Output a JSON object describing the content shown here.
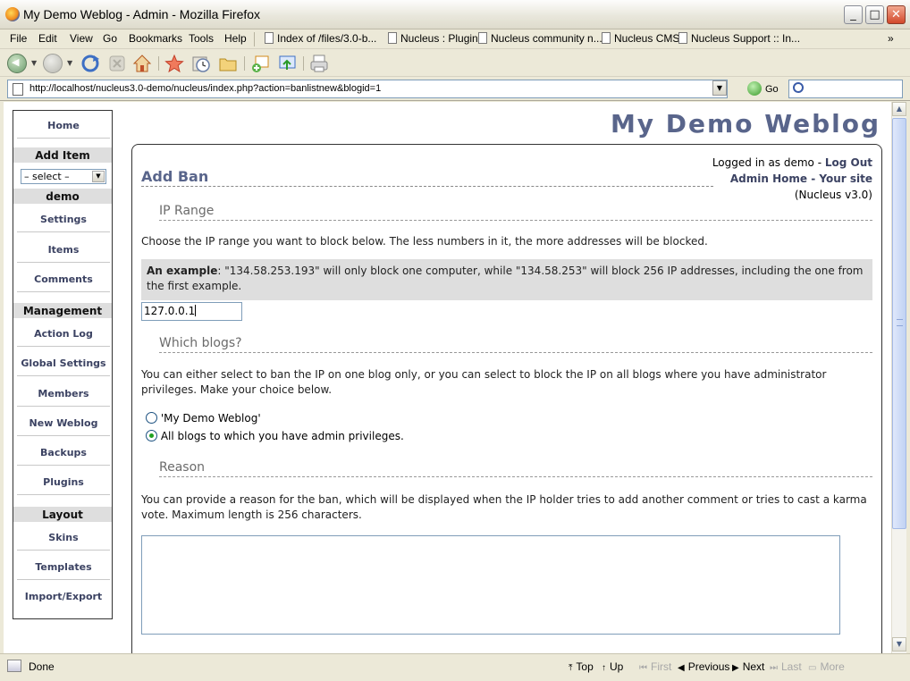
{
  "window": {
    "title": "My Demo Weblog - Admin - Mozilla Firefox",
    "buttons": {
      "minimize": "_",
      "maximize": "□",
      "close": "✕"
    }
  },
  "menubar": {
    "items": [
      "File",
      "Edit",
      "View",
      "Go",
      "Bookmarks",
      "Tools",
      "Help"
    ],
    "accel": [
      "F",
      "E",
      "V",
      "G",
      "B",
      "T",
      "H"
    ],
    "bookmarks": [
      "Index of /files/3.0-b...",
      "Nucleus : Plugin",
      "Nucleus community n...",
      "Nucleus CMS",
      "Nucleus Support :: In..."
    ],
    "overflow": "»"
  },
  "toolbar": {
    "icons": [
      "back-icon",
      "forward-icon",
      "reload-icon",
      "stop-icon",
      "home-icon",
      "bookmark-star-icon",
      "history-icon",
      "folder-icon",
      "new-window-icon",
      "new-tab-icon",
      "print-icon"
    ]
  },
  "urlbar": {
    "url": "http://localhost/nucleus3.0-demo/nucleus/index.php?action=banlistnew&blogid=1",
    "go_label": "Go",
    "search_placeholder": ""
  },
  "sidebar": {
    "home": "Home",
    "add_item_heading": "Add Item",
    "select_value": "– select –",
    "blog_heading": "demo",
    "blog_links": [
      "Settings",
      "Items",
      "Comments"
    ],
    "management_heading": "Management",
    "management_links": [
      "Action Log",
      "Global Settings",
      "Members",
      "New Weblog",
      "Backups",
      "Plugins"
    ],
    "layout_heading": "Layout",
    "layout_links": [
      "Skins",
      "Templates",
      "Import/Export"
    ]
  },
  "page": {
    "site_title": "My Demo Weblog",
    "login": {
      "logged_in_as": "Logged in as demo - ",
      "logout": "Log Out",
      "admin_home": "Admin Home",
      "separator": " - ",
      "your_site": "Your site",
      "version": "(Nucleus v3.0)"
    },
    "heading": "Add Ban",
    "ip_range": {
      "heading": "IP Range",
      "description": "Choose the IP range you want to block below. The less numbers in it, the more addresses will be blocked.",
      "example_label": "An example",
      "example_text": ": \"134.58.253.193\" will only block one computer, while \"134.58.253\" will block 256 IP addresses, including the one from the first example.",
      "value": "127.0.0.1"
    },
    "blogs": {
      "heading": "Which blogs?",
      "description": "You can either select to ban the IP on one blog only, or you can select to block the IP on all blogs where you have administrator privileges. Make your choice below.",
      "option_one": "'My Demo Weblog'",
      "option_all": "All blogs to which you have admin privileges.",
      "selected": "all"
    },
    "reason": {
      "heading": "Reason",
      "description": "You can provide a reason for the ban, which will be displayed when the IP holder tries to add another comment or tries to cast a karma vote. Maximum length is 256 characters.",
      "value": ""
    }
  },
  "statusbar": {
    "status": "Done",
    "find": {
      "top": "Top",
      "up": "Up",
      "first": "First",
      "previous": "Previous",
      "next": "Next",
      "last": "Last",
      "more": "More"
    }
  }
}
